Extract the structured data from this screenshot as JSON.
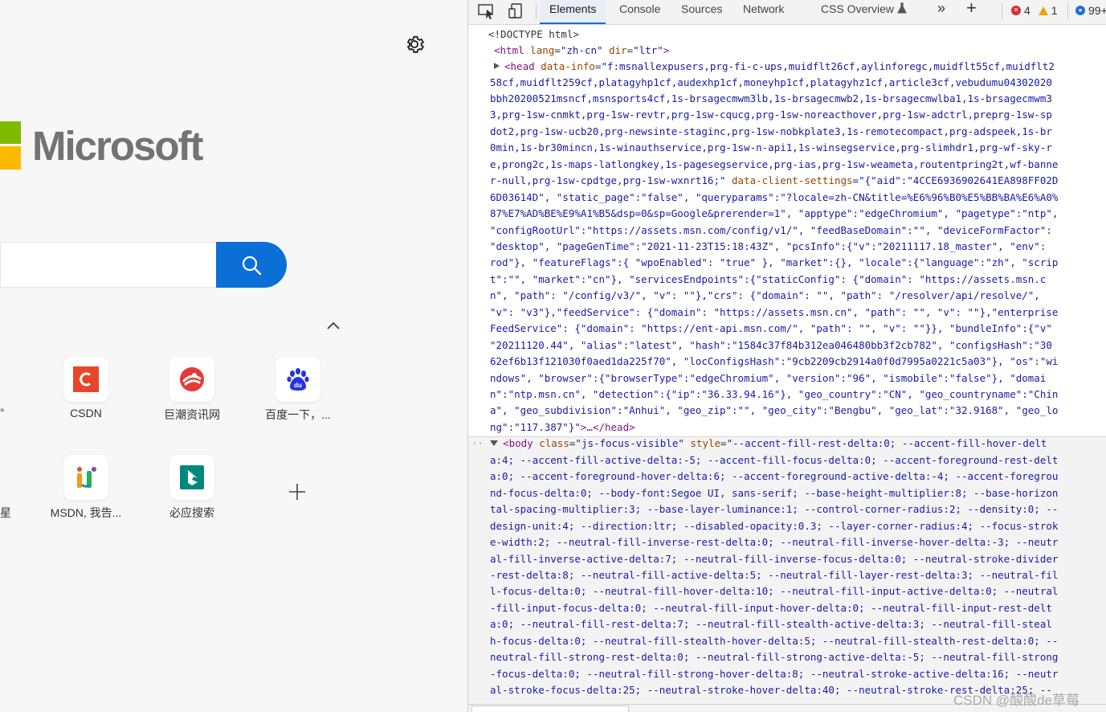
{
  "ntp": {
    "logo_text": "Microsoft",
    "tiles": [
      {
        "label": "CSDN",
        "icon": "csdn-icon"
      },
      {
        "label": "巨潮资讯网",
        "icon": "cninfo-icon"
      },
      {
        "label": "百度一下，...",
        "icon": "baidu-paw-icon"
      },
      {
        "label": "MSDN, 我告...",
        "icon": "msdn-itellyou-icon"
      },
      {
        "label": "必应搜索",
        "icon": "bing-icon"
      }
    ],
    "partial_labels": [
      "°",
      "星"
    ]
  },
  "devtools": {
    "tabs": [
      {
        "label": "Elements",
        "active": true
      },
      {
        "label": "Console"
      },
      {
        "label": "Sources"
      },
      {
        "label": "Network"
      },
      {
        "label": "CSS Overview"
      }
    ],
    "more_symbol": "»",
    "add_symbol": "+",
    "errors_count": "4",
    "warnings_count": "1",
    "issues_count": "99+",
    "accent": "#0a6fd6"
  },
  "dom_top": [
    {
      "type": "plain",
      "text": "<!DOCTYPE html>"
    },
    {
      "type": "html",
      "tag_open": "<html",
      "a1": "lang",
      "v1": "\"zh-cn\"",
      "a2": "dir",
      "v2": "\"ltr\"",
      "tag_close": ">"
    },
    {
      "type": "head",
      "tag_open": "<head",
      "attr": "data-info",
      "value": "\"f:msnallexpusers,prg-fi-c-ups,muidflt26cf,aylinforegc,muidflt55cf,muidflt2"
    },
    {
      "type": "cont",
      "text": "58cf,muidflt259cf,platagyhp1cf,audexhp1cf,moneyhp1cf,platagyhz1cf,article3cf,vebudumu04302020"
    },
    {
      "type": "cont",
      "text": "bbh20200521msncf,msnsports4cf,1s-brsagecmwm3lb,1s-brsagecmwb2,1s-brsagecmwlba1,1s-brsagecmwm3"
    },
    {
      "type": "cont",
      "text": "3,prg-1sw-cnmkt,prg-1sw-revtr,prg-1sw-cqucg,prg-1sw-noreacthover,prg-1sw-adctrl,preprg-1sw-sp"
    },
    {
      "type": "cont",
      "text": "dot2,prg-1sw-ucb20,prg-newsinte-staginc,prg-1sw-nobkplate3,1s-remotecompact,prg-adspeek,1s-br"
    },
    {
      "type": "cont",
      "text": "0min,1s-br30mincn,1s-winauthservice,prg-1sw-n-api1,1s-winsegservice,prg-slimhdr1,prg-wf-sky-r"
    },
    {
      "type": "cont",
      "text": "e,prong2c,1s-maps-latlongkey,1s-pagesegservice,prg-ias,prg-1sw-weameta,routentpring2t,wf-banne"
    },
    {
      "type": "mixed",
      "pre": "r-null,prg-1sw-cpdtge,prg-1sw-wxnrt16;\"",
      "attr": "data-client-settings",
      "post": "=\"{\"aid\":\"4CCE6936902641EA898FF02D"
    },
    {
      "type": "cont",
      "text": "6D03614D\", \"static_page\":\"false\", \"queryparams\":\"?locale=zh-CN&title=%E6%96%B0%E5%BB%BA%E6%A0%"
    },
    {
      "type": "cont",
      "text": "87%E7%AD%BE%E9%A1%B5&dsp=0&sp=Google&prerender=1\", \"apptype\":\"edgeChromium\", \"pagetype\":\"ntp\","
    },
    {
      "type": "cont",
      "text": "\"configRootUrl\":\"https://assets.msn.com/config/v1/\", \"feedBaseDomain\":\"\", \"deviceFormFactor\":"
    },
    {
      "type": "cont",
      "text": "\"desktop\", \"pageGenTime\":\"2021-11-23T15:18:43Z\", \"pcsInfo\":{\"v\":\"20211117.18_master\", \"env\":"
    },
    {
      "type": "cont",
      "text": "rod\"}, \"featureFlags\":{ \"wpoEnabled\": \"true\" }, \"market\":{}, \"locale\":{\"language\":\"zh\", \"scrip"
    },
    {
      "type": "cont",
      "text": "t\":\"\", \"market\":\"cn\"}, \"servicesEndpoints\":{\"staticConfig\": {\"domain\": \"https://assets.msn.c"
    },
    {
      "type": "cont",
      "text": "n\", \"path\": \"/config/v3/\", \"v\": \"\"},\"crs\": {\"domain\": \"\", \"path\": \"/resolver/api/resolve/\","
    },
    {
      "type": "cont",
      "text": "\"v\": \"v3\"},\"feedService\": {\"domain\": \"https://assets.msn.cn\", \"path\": \"\", \"v\": \"\"},\"enterprise"
    },
    {
      "type": "cont",
      "text": "FeedService\": {\"domain\": \"https://ent-api.msn.com/\", \"path\": \"\", \"v\": \"\"}}, \"bundleInfo\":{\"v\""
    },
    {
      "type": "cont",
      "text": "\"20211120.44\", \"alias\":\"latest\", \"hash\":\"1584c37f84b312ea046480bb3f2cb782\", \"configsHash\":\"30"
    },
    {
      "type": "cont",
      "text": "62ef6b13f121030f0aed1da225f70\", \"locConfigsHash\":\"9cb2209cb2914a0f0d7995a0221c5a03\"}, \"os\":\"wi"
    },
    {
      "type": "cont",
      "text": "ndows\", \"browser\":{\"browserType\":\"edgeChromium\", \"version\":\"96\", \"ismobile\":\"false\"}, \"domai"
    },
    {
      "type": "cont",
      "text": "n\":\"ntp.msn.cn\", \"detection\":{\"ip\":\"36.33.94.16\"}, \"geo_country\":\"CN\", \"geo_countryname\":\"Chin"
    },
    {
      "type": "cont",
      "text": "a\", \"geo_subdivision\":\"Anhui\", \"geo_zip\":\"\", \"geo_city\":\"Bengbu\", \"geo_lat\":\"32.9168\", \"geo_lo"
    },
    {
      "type": "end",
      "text": "ng\":\"117.387\"}\"",
      "close": ">…</head>"
    }
  ],
  "dom_body": [
    {
      "type": "body",
      "tag_open": "<body",
      "a1": "class",
      "v1": "\"js-focus-visible\"",
      "a2": "style",
      "v2": "\"--accent-fill-rest-delta:0; --accent-fill-hover-delt"
    },
    {
      "type": "cont",
      "text": "a:4; --accent-fill-active-delta:-5; --accent-fill-focus-delta:0; --accent-foreground-rest-delt"
    },
    {
      "type": "cont",
      "text": "a:0; --accent-foreground-hover-delta:6; --accent-foreground-active-delta:-4; --accent-foregrou"
    },
    {
      "type": "cont",
      "text": "nd-focus-delta:0; --body-font:Segoe UI, sans-serif; --base-height-multiplier:8; --base-horizon"
    },
    {
      "type": "cont",
      "text": "tal-spacing-multiplier:3; --base-layer-luminance:1; --control-corner-radius:2; --density:0; --"
    },
    {
      "type": "cont",
      "text": "design-unit:4; --direction:ltr; --disabled-opacity:0.3; --layer-corner-radius:4; --focus-strok"
    },
    {
      "type": "cont",
      "text": "e-width:2; --neutral-fill-inverse-rest-delta:0; --neutral-fill-inverse-hover-delta:-3; --neutr"
    },
    {
      "type": "cont",
      "text": "al-fill-inverse-active-delta:7; --neutral-fill-inverse-focus-delta:0; --neutral-stroke-divider"
    },
    {
      "type": "cont",
      "text": "-rest-delta:8; --neutral-fill-active-delta:5; --neutral-fill-layer-rest-delta:3; --neutral-fil"
    },
    {
      "type": "cont",
      "text": "l-focus-delta:0; --neutral-fill-hover-delta:10; --neutral-fill-input-active-delta:0; --neutral"
    },
    {
      "type": "cont",
      "text": "-fill-input-focus-delta:0; --neutral-fill-input-hover-delta:0; --neutral-fill-input-rest-delt"
    },
    {
      "type": "cont",
      "text": "a:0; --neutral-fill-rest-delta:7; --neutral-fill-stealth-active-delta:3; --neutral-fill-steal"
    },
    {
      "type": "cont",
      "text": "h-focus-delta:0; --neutral-fill-stealth-hover-delta:5; --neutral-fill-stealth-rest-delta:0; --"
    },
    {
      "type": "cont",
      "text": "neutral-fill-strong-rest-delta:0; --neutral-fill-strong-active-delta:-5; --neutral-fill-strong"
    },
    {
      "type": "cont",
      "text": "-focus-delta:0; --neutral-fill-strong-hover-delta:8; --neutral-stroke-active-delta:16; --neutr"
    },
    {
      "type": "cont",
      "text": "al-stroke-focus-delta:25; --neutral-stroke-hover-delta:40; --neutral-stroke-rest-delta:25; --"
    }
  ],
  "watermark": "CSDN @酸酸de草莓"
}
